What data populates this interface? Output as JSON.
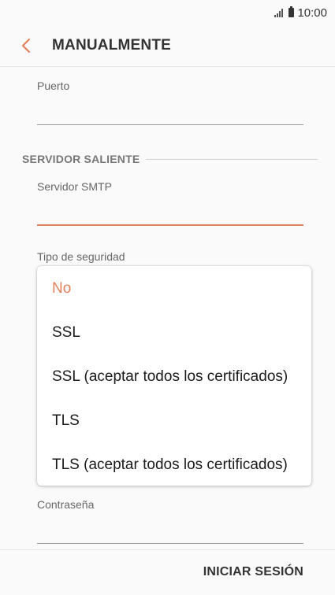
{
  "status_bar": {
    "time": "10:00"
  },
  "app_bar": {
    "title": "MANUALMENTE",
    "back_icon": "chevron-left-icon"
  },
  "form": {
    "port_label": "Puerto",
    "outgoing_section_title": "SERVIDOR SALIENTE",
    "smtp_label": "Servidor SMTP",
    "smtp_value": "",
    "security_label": "Tipo de seguridad",
    "password_label": "Contraseña"
  },
  "dropdown": {
    "options": [
      {
        "label": "No",
        "selected": true
      },
      {
        "label": "SSL",
        "selected": false
      },
      {
        "label": "SSL (aceptar todos los certificados)",
        "selected": false
      },
      {
        "label": "TLS",
        "selected": false
      },
      {
        "label": "TLS (aceptar todos los certificados)",
        "selected": false
      }
    ]
  },
  "footer": {
    "login_label": "INICIAR SESIÓN"
  },
  "colors": {
    "accent": "#e0835c",
    "background": "#fafafa"
  }
}
